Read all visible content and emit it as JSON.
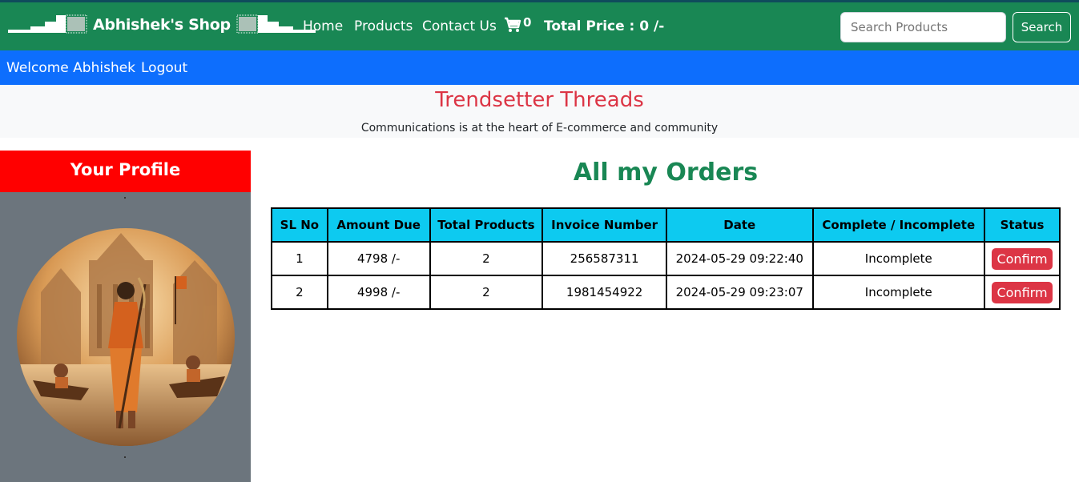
{
  "navbar": {
    "brand": "Abhishek's Shop",
    "links": [
      "Home",
      "Products",
      "Contact Us"
    ],
    "cart_count": "0",
    "total_price": "Total Price : 0 /-",
    "search_placeholder": "Search Products",
    "search_button": "Search",
    "icons": {
      "cart": "cart-icon",
      "logo": "logo-icon"
    }
  },
  "userbar": {
    "welcome": "Welcome Abhishek",
    "logout": "Logout"
  },
  "hero": {
    "title": "Trendsetter Threads",
    "subtitle": "Communications is at the heart of E-commerce and community"
  },
  "sidebar": {
    "heading": "Your Profile"
  },
  "orders": {
    "title": "All my Orders",
    "columns": [
      "SL No",
      "Amount Due",
      "Total Products",
      "Invoice Number",
      "Date",
      "Complete / Incomplete",
      "Status"
    ],
    "rows": [
      {
        "sl": "1",
        "amount": "4798 /-",
        "products": "2",
        "invoice": "256587311",
        "date": "2024-05-29 09:22:40",
        "complete": "Incomplete",
        "status": "Confirm"
      },
      {
        "sl": "2",
        "amount": "4998 /-",
        "products": "2",
        "invoice": "1981454922",
        "date": "2024-05-29 09:23:07",
        "complete": "Incomplete",
        "status": "Confirm"
      }
    ]
  },
  "colors": {
    "navbar": "#198754",
    "userbar": "#0d6efd",
    "hero_title": "#dc3545",
    "profile_header": "#ff0000",
    "sidebar": "#6c757d",
    "table_header": "#0dcaf0",
    "confirm_button": "#dc3545"
  }
}
